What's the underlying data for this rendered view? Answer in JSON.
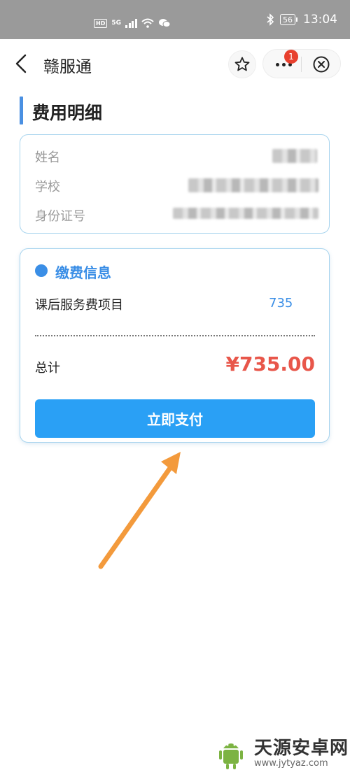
{
  "status_bar": {
    "hd": "HD",
    "network": "5G",
    "battery": "56",
    "time": "13:04"
  },
  "nav": {
    "title": "赣服通",
    "badge_count": "1"
  },
  "page": {
    "heading": "费用明细"
  },
  "info": {
    "rows": [
      {
        "label": "姓名"
      },
      {
        "label": "学校"
      },
      {
        "label": "身份证号"
      }
    ]
  },
  "payment": {
    "title": "缴费信息",
    "item_label": "课后服务费项目",
    "item_value": "735",
    "total_label": "总计",
    "total_value": "¥735.00",
    "pay_button": "立即支付"
  },
  "watermark": {
    "name": "天源安卓网",
    "url": "www.jytyaz.com"
  },
  "colors": {
    "accent": "#3a8ee6",
    "button": "#2aa0f5",
    "total": "#e8564a",
    "arrow": "#f39a3c",
    "card_border": "#a8d4ee"
  }
}
